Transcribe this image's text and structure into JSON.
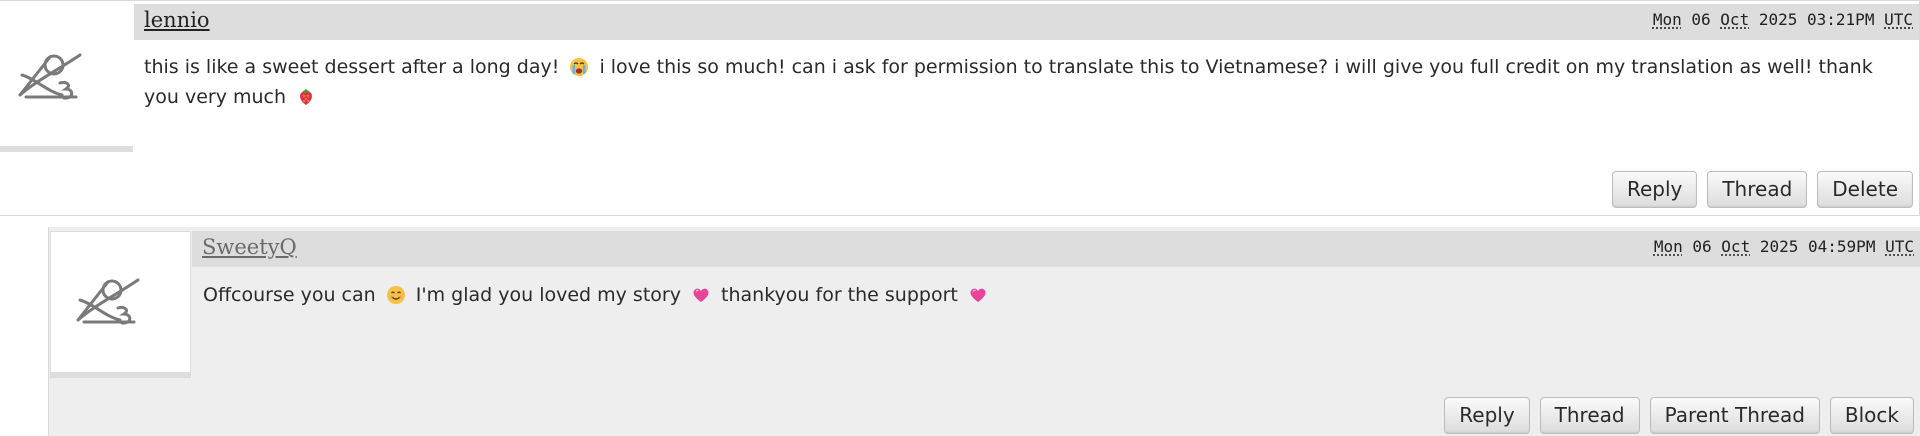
{
  "comments": [
    {
      "username": "lennio",
      "date": {
        "weekday": "Mon",
        "day": "06",
        "month": "Oct",
        "year": "2025",
        "time": "03:21PM",
        "timezone": "UTC"
      },
      "text": {
        "part1": "this is like a sweet dessert after a long day!",
        "emoji1": "😭",
        "part2": "i love this so much! can i ask for permission to translate this to Vietnamese? i will give you full credit on my translation as well! thank you very much",
        "emoji2": "🍓"
      },
      "actions": {
        "reply": "Reply",
        "thread": "Thread",
        "delete": "Delete"
      }
    },
    {
      "username": "SweetyQ",
      "date": {
        "weekday": "Mon",
        "day": "06",
        "month": "Oct",
        "year": "2025",
        "time": "04:59PM",
        "timezone": "UTC"
      },
      "text": {
        "part1": "Offcourse you can",
        "emoji1": "😊",
        "part2": "I'm glad you loved my story",
        "emoji2": "💗",
        "part3": "thankyou for the support",
        "emoji3": "💗"
      },
      "actions": {
        "reply": "Reply",
        "thread": "Thread",
        "parent_thread": "Parent Thread",
        "block": "Block"
      }
    }
  ],
  "icons": {
    "avatar": "default-avatar-icon",
    "emoji_tearful": "crying-face-emoji-icon",
    "emoji_strawberry": "strawberry-emoji-icon",
    "emoji_smile": "smiling-face-emoji-icon",
    "emoji_heart": "pink-heart-emoji-icon"
  },
  "colors": {
    "byline_bg": "#dddddd",
    "reply_bg": "#eeeeee",
    "heart": "#e8449a"
  }
}
